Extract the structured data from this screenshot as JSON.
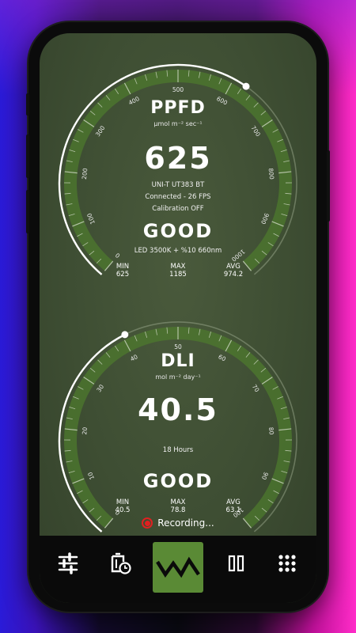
{
  "ppfd": {
    "title": "PPFD",
    "unit": "μmol m⁻² sec⁻¹",
    "value": "625",
    "device": "UNI-T UT383 BT",
    "connection": "Connected - 26 FPS",
    "calibration": "Calibration OFF",
    "status": "GOOD",
    "light": "LED 3500K + %10 660nm",
    "ticks": [
      "0",
      "100",
      "200",
      "300",
      "400",
      "500",
      "600",
      "700",
      "800",
      "900",
      "1000"
    ],
    "level": 0.625,
    "stats": {
      "min_label": "MIN",
      "min": "625",
      "max_label": "MAX",
      "max": "1185",
      "avg_label": "AVG",
      "avg": "974.2"
    }
  },
  "dli": {
    "title": "DLI",
    "unit": "mol m⁻² day⁻¹",
    "value": "40.5",
    "hours": "18 Hours",
    "status": "GOOD",
    "ticks": [
      "0",
      "10",
      "20",
      "30",
      "40",
      "50",
      "60",
      "70",
      "80",
      "90",
      "100"
    ],
    "level": 0.405,
    "stats": {
      "min_label": "MIN",
      "min": "40.5",
      "max_label": "MAX",
      "max": "78.8",
      "avg_label": "AVG",
      "avg": "63.1"
    }
  },
  "recording": {
    "label": "Recording..."
  },
  "nav": {
    "items": [
      "sliders-icon",
      "history-clock-icon",
      "waveform-icon",
      "pause-icon",
      "grid-dots-icon"
    ]
  },
  "colors": {
    "accent": "#5a8a35",
    "track": "#4d7a2e",
    "screen": "#3e4e33",
    "record": "#e02020"
  }
}
